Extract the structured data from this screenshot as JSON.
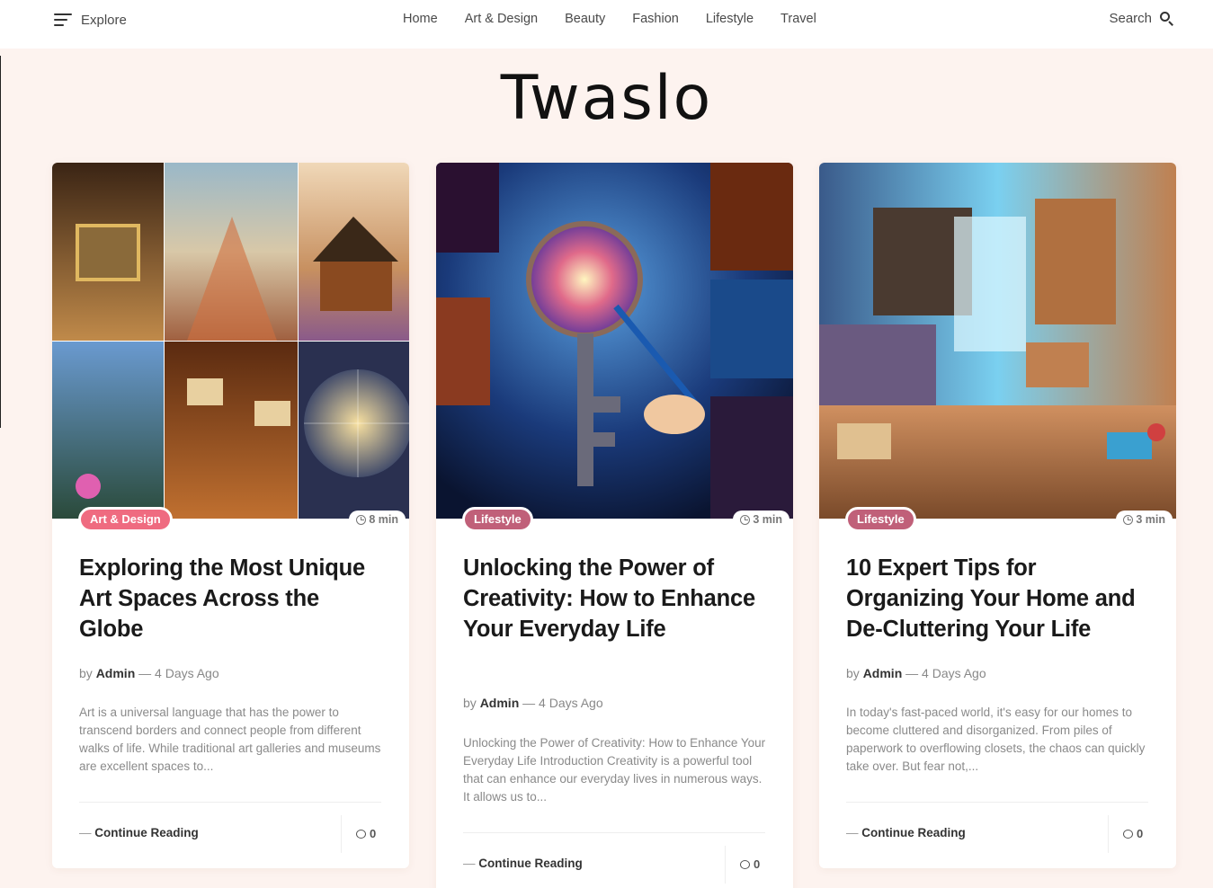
{
  "header": {
    "explore_label": "Explore",
    "nav": [
      "Home",
      "Art & Design",
      "Beauty",
      "Fashion",
      "Lifestyle",
      "Travel"
    ],
    "search_label": "Search"
  },
  "site": {
    "logo": "Twaslo"
  },
  "colors": {
    "art_badge": "#ef6b80",
    "lifestyle_badge": "#c06079",
    "background": "#fdf3ef"
  },
  "posts": [
    {
      "category": "Art & Design",
      "read_time": "8 min",
      "title": "Exploring the Most Unique Art Spaces Across the Globe",
      "by": "by",
      "author": "Admin",
      "sep": "—",
      "date": "4 Days Ago",
      "excerpt": "Art is a universal language that has the power to transcend borders and connect people from different walks of life. While traditional art galleries and museums are excellent spaces to...",
      "continue": "Continue Reading",
      "comments": "0"
    },
    {
      "category": "Lifestyle",
      "read_time": "3 min",
      "title": "Unlocking the Power of Creativity: How to Enhance Your Everyday Life",
      "by": "by",
      "author": "Admin",
      "sep": "—",
      "date": "4 Days Ago",
      "excerpt": "Unlocking the Power of Creativity: How to Enhance Your Everyday Life Introduction Creativity is a powerful tool that can enhance our everyday lives in numerous ways. It allows us to...",
      "continue": "Continue Reading",
      "comments": "0"
    },
    {
      "category": "Lifestyle",
      "read_time": "3 min",
      "title": "10 Expert Tips for Organizing Your Home and De-Cluttering Your Life",
      "by": "by",
      "author": "Admin",
      "sep": "—",
      "date": "4 Days Ago",
      "excerpt": "In today's fast-paced world, it's easy for our homes to become cluttered and disorganized. From piles of paperwork to overflowing closets, the chaos can quickly take over. But fear not,...",
      "continue": "Continue Reading",
      "comments": "0"
    }
  ]
}
